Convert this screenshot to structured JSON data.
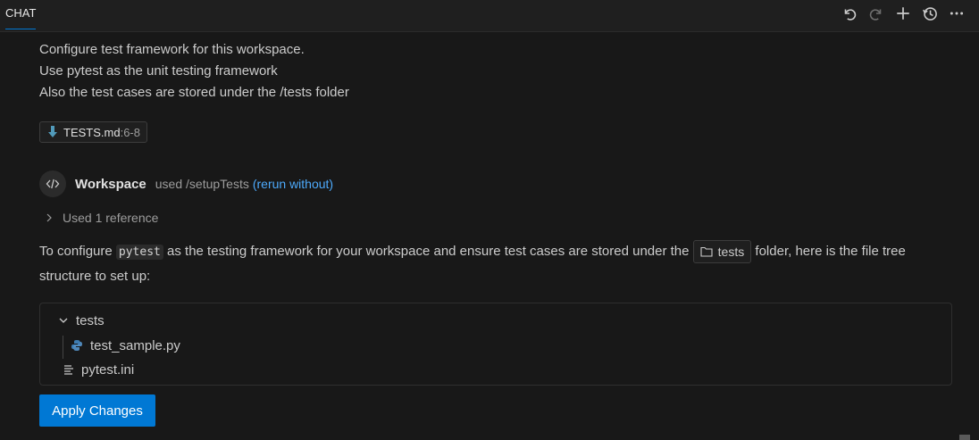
{
  "header": {
    "tab_label": "CHAT",
    "actions": [
      {
        "name": "undo-icon"
      },
      {
        "name": "redo-icon"
      },
      {
        "name": "new-chat-icon"
      },
      {
        "name": "history-icon"
      },
      {
        "name": "more-icon"
      }
    ]
  },
  "request": {
    "lines": [
      "Configure test framework for this workspace.",
      "Use pytest as the unit testing framework",
      "Also the test cases are stored under the /tests folder"
    ],
    "reference_chip": {
      "label": "TESTS.md",
      "range": ":6-8"
    }
  },
  "response": {
    "agent_name": "Workspace",
    "used_text": "used /setupTests",
    "rerun_link": "(rerun without)",
    "references_toggle": "Used 1 reference",
    "answer": {
      "part1": "To configure ",
      "code": "pytest",
      "part2": " as the testing framework for your workspace and ensure test cases are stored under the ",
      "folder": "tests",
      "part3": " folder, here is the file tree structure to set up:"
    },
    "file_tree": {
      "folder": "tests",
      "child_file": "test_sample.py",
      "root_file": "pytest.ini"
    },
    "apply_button": "Apply Changes"
  },
  "colors": {
    "accent": "#0078d4",
    "link": "#4daafc",
    "background": "#181818"
  }
}
